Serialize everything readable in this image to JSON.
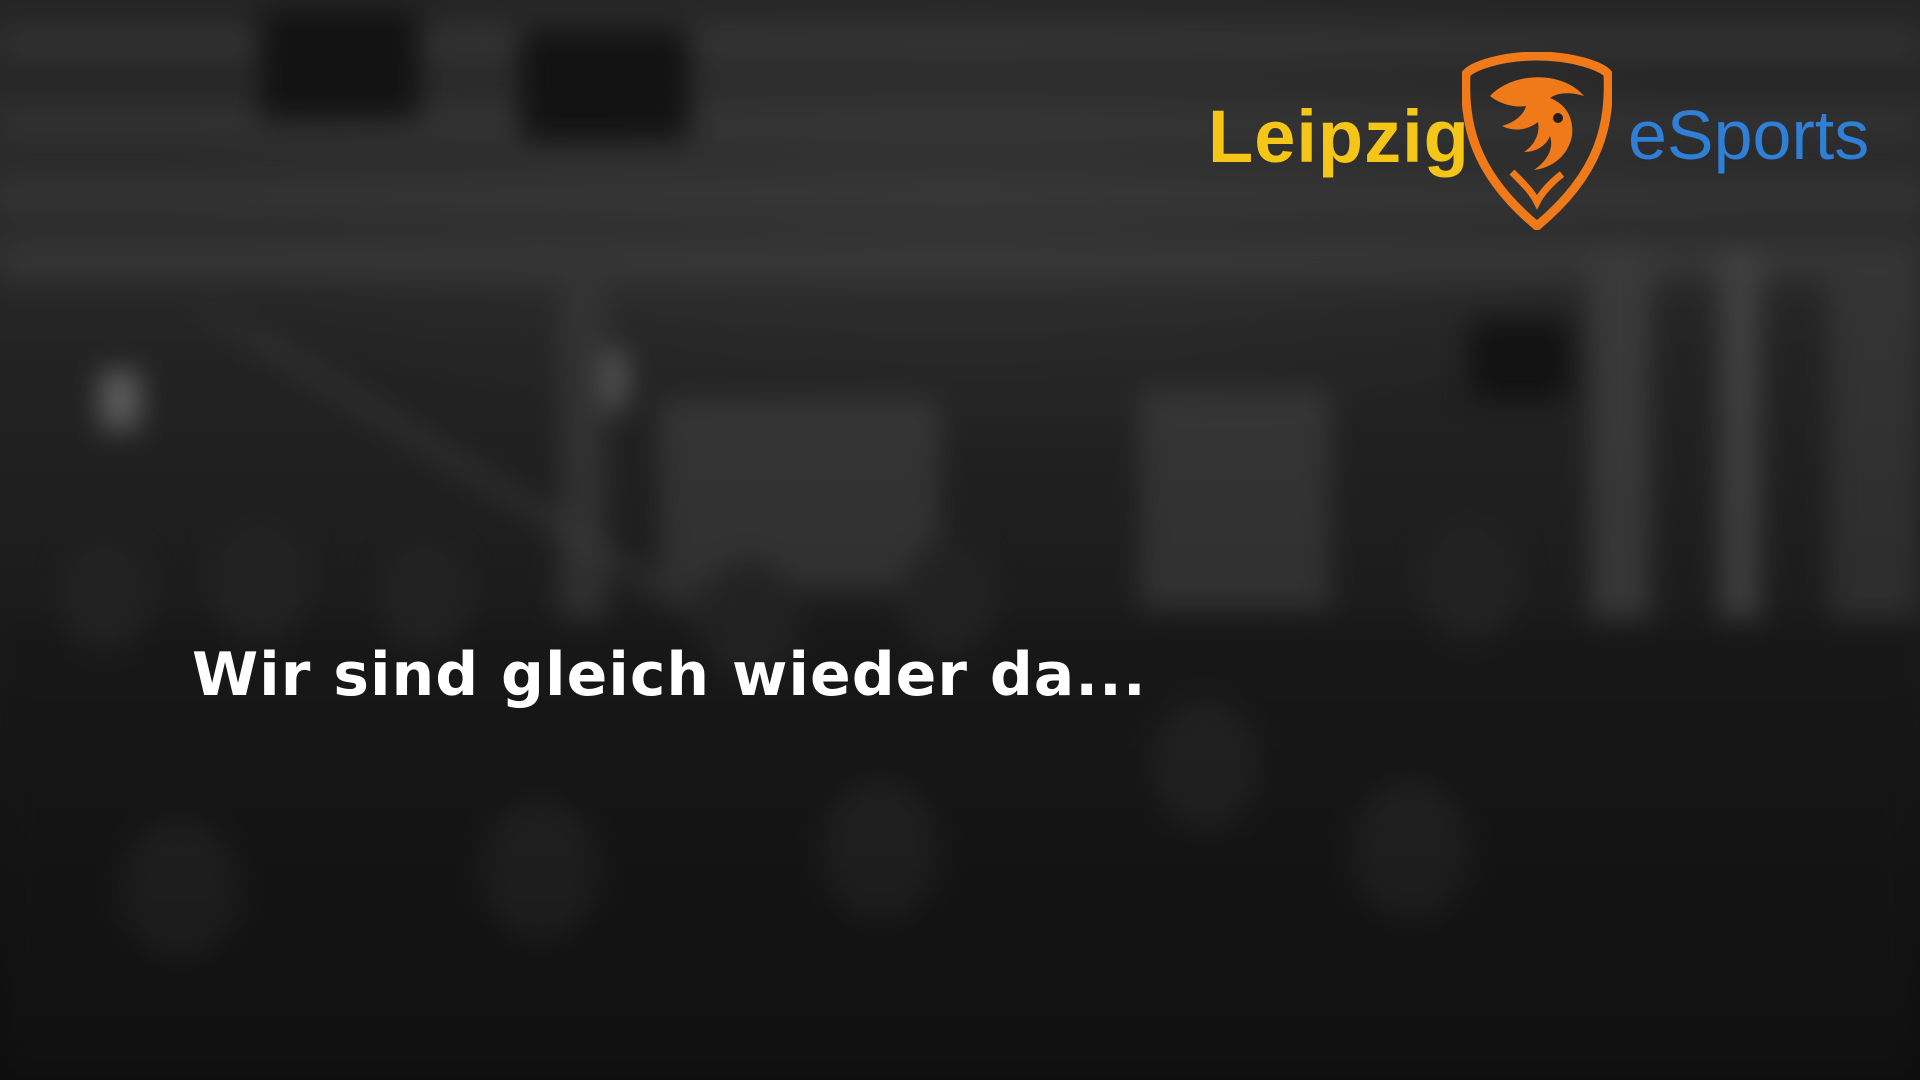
{
  "brand": {
    "name_left": "Leipzig",
    "name_right": "eSports",
    "colors": {
      "left": "#f5c518",
      "right": "#2f7fd6",
      "shield": "#f07a1a"
    },
    "emblem": "lion-shield-icon"
  },
  "message": {
    "text": "Wir sind gleich wieder da..."
  }
}
